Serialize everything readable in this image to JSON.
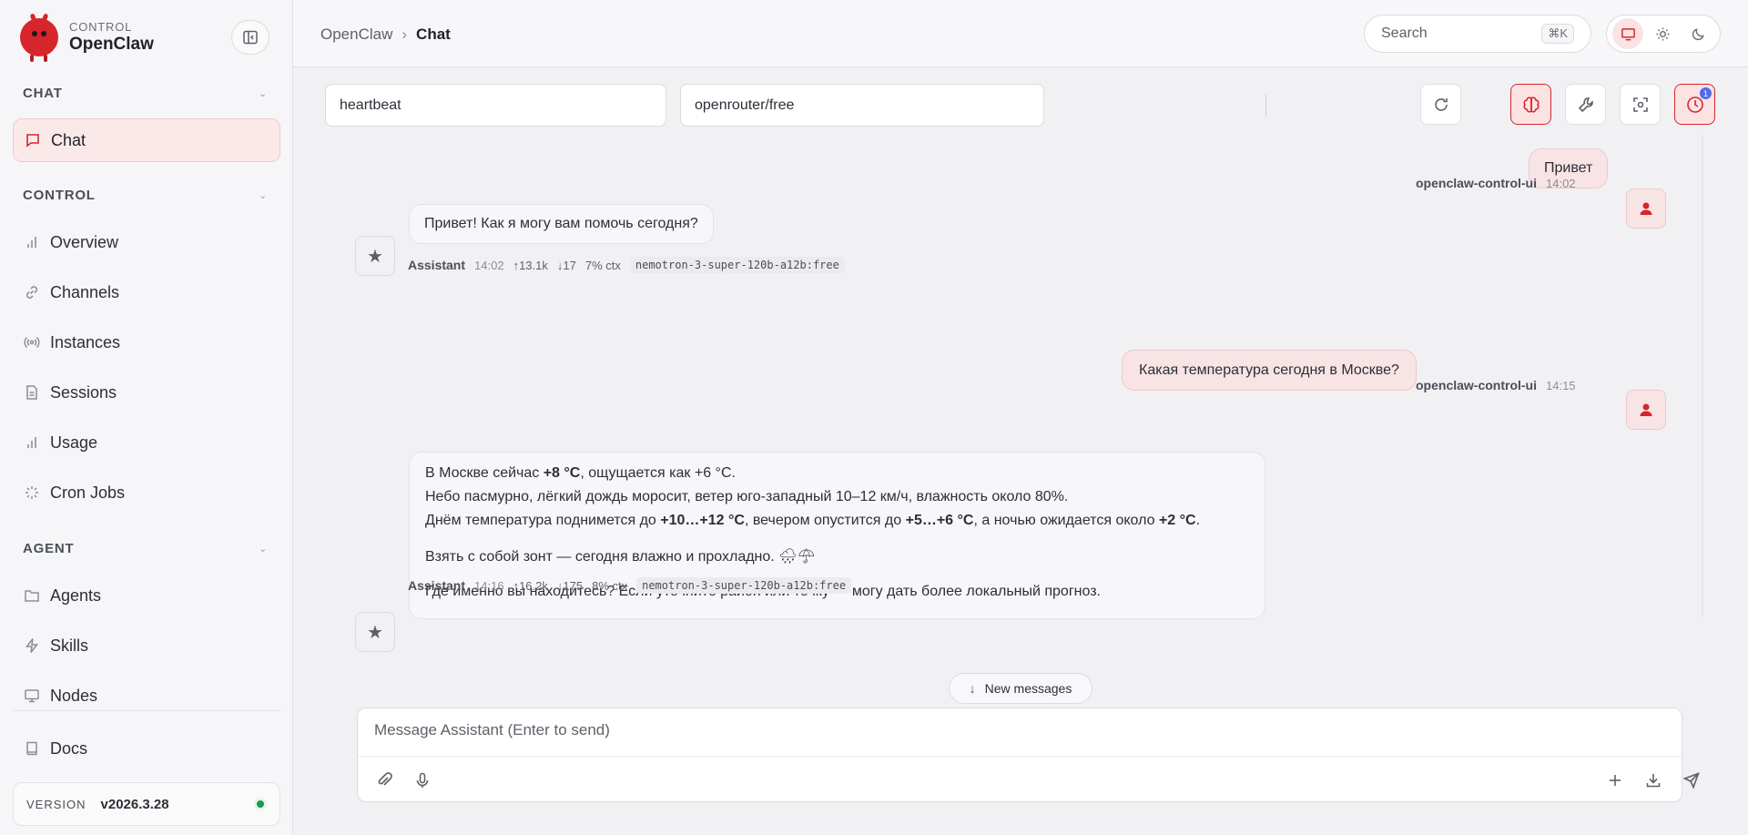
{
  "sidebar": {
    "brand_kicker": "CONTROL",
    "brand_name": "OpenClaw",
    "sections": {
      "chat": "CHAT",
      "control": "CONTROL",
      "agent": "AGENT"
    },
    "items": {
      "chat": "Chat",
      "overview": "Overview",
      "channels": "Channels",
      "instances": "Instances",
      "sessions": "Sessions",
      "usage": "Usage",
      "cron": "Cron Jobs",
      "agents": "Agents",
      "skills": "Skills",
      "nodes": "Nodes",
      "docs": "Docs"
    },
    "version_label": "VERSION",
    "version_value": "v2026.3.28"
  },
  "header": {
    "crumb_root": "OpenClaw",
    "crumb_sep": "›",
    "crumb_current": "Chat",
    "search_placeholder": "Search",
    "search_shortcut": "⌘K"
  },
  "toolbar": {
    "session": "heartbeat",
    "model": "openrouter/free",
    "clock_badge": "1"
  },
  "messages": [
    {
      "role": "user",
      "text": "Привет",
      "sender": "openclaw-control-ui",
      "time": "14:02"
    },
    {
      "role": "assistant",
      "text": "Привет! Как я могу вам помочь сегодня?",
      "sender": "Assistant",
      "time": "14:02",
      "tokens_in": "↑13.1k",
      "tokens_out": "↓17",
      "ctx": "7% ctx",
      "model": "nemotron-3-super-120b-a12b:free"
    },
    {
      "role": "user",
      "text": "Какая температура сегодня в Москве?",
      "sender": "openclaw-control-ui",
      "time": "14:15"
    },
    {
      "role": "assistant",
      "sender": "Assistant",
      "time": "14:16",
      "tokens_in": "↑16.2k",
      "tokens_out": "↓175",
      "ctx": "8% ctx",
      "model": "nemotron-3-super-120b-a12b:free",
      "lines": {
        "l1a": "В Москве сейчас ",
        "l1b": "+8 °C",
        "l1c": ", ощущается как +6 °C.",
        "l2": "Небо пасмурно, лёгкий дождь моросит, ветер юго-западный 10–12 км/ч, влажность около 80%.",
        "l3a": "Днём температура поднимется до ",
        "l3b": "+10…+12 °C",
        "l3c": ", вечером опустится до ",
        "l3d": "+5…+6 °C",
        "l3e": ", а ночью ожидается около ",
        "l3f": "+2 °C",
        "l3g": ".",
        "l4": "Взять с собой зонт — сегодня влажно и прохладно. 🌧☂",
        "l5": "Где именно вы находитесь? Если уточните район или точку — могу дать более локальный прогноз."
      }
    }
  ],
  "new_messages": "New messages",
  "composer": {
    "placeholder": "Message Assistant (Enter to send)"
  }
}
